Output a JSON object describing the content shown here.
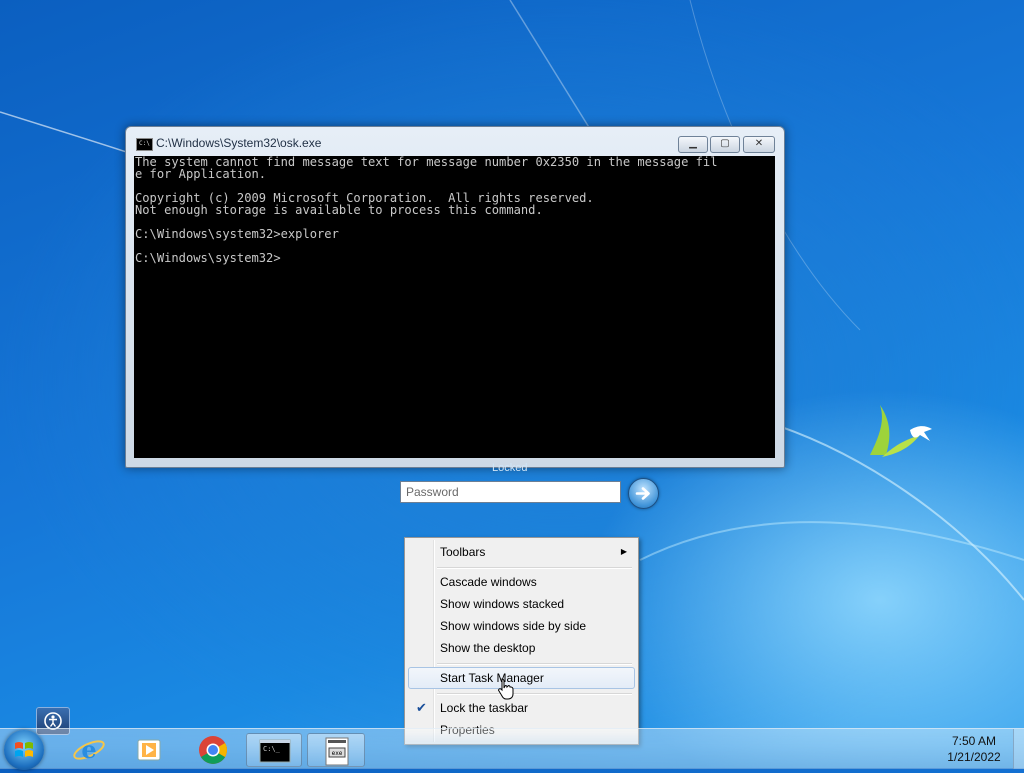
{
  "console": {
    "title": "C:\\Windows\\System32\\osk.exe",
    "icon_text": "C:\\",
    "lines": [
      "The system cannot find message text for message number 0x2350 in the message fil",
      "e for Application.",
      "",
      "Copyright (c) 2009 Microsoft Corporation.  All rights reserved.",
      "Not enough storage is available to process this command.",
      "",
      "C:\\Windows\\system32>explorer",
      "",
      "C:\\Windows\\system32>"
    ]
  },
  "lock": {
    "label": "Locked",
    "password_placeholder": "Password"
  },
  "context_menu": {
    "items": {
      "toolbars": "Toolbars",
      "cascade": "Cascade windows",
      "stacked": "Show windows stacked",
      "side_by_side": "Show windows side by side",
      "desktop": "Show the desktop",
      "task_manager": "Start Task Manager",
      "lock_taskbar": "Lock the taskbar",
      "properties": "Properties"
    },
    "lock_taskbar_checked": true,
    "hovered_item": "Start Task Manager"
  },
  "taskbar": {
    "pinned": [
      "start-orb",
      "internet-explorer-icon",
      "media-player-icon",
      "chrome-icon",
      "console-icon",
      "osk-icon"
    ],
    "clock": {
      "time": "7:50 AM",
      "date": "1/21/2022"
    }
  },
  "colors": {
    "desktop": "#1677d8",
    "console_bg": "#000000",
    "console_text": "#c8c8c8",
    "menu_bg": "#f0f0f0",
    "menu_hover_border": "#a8c4e4"
  }
}
